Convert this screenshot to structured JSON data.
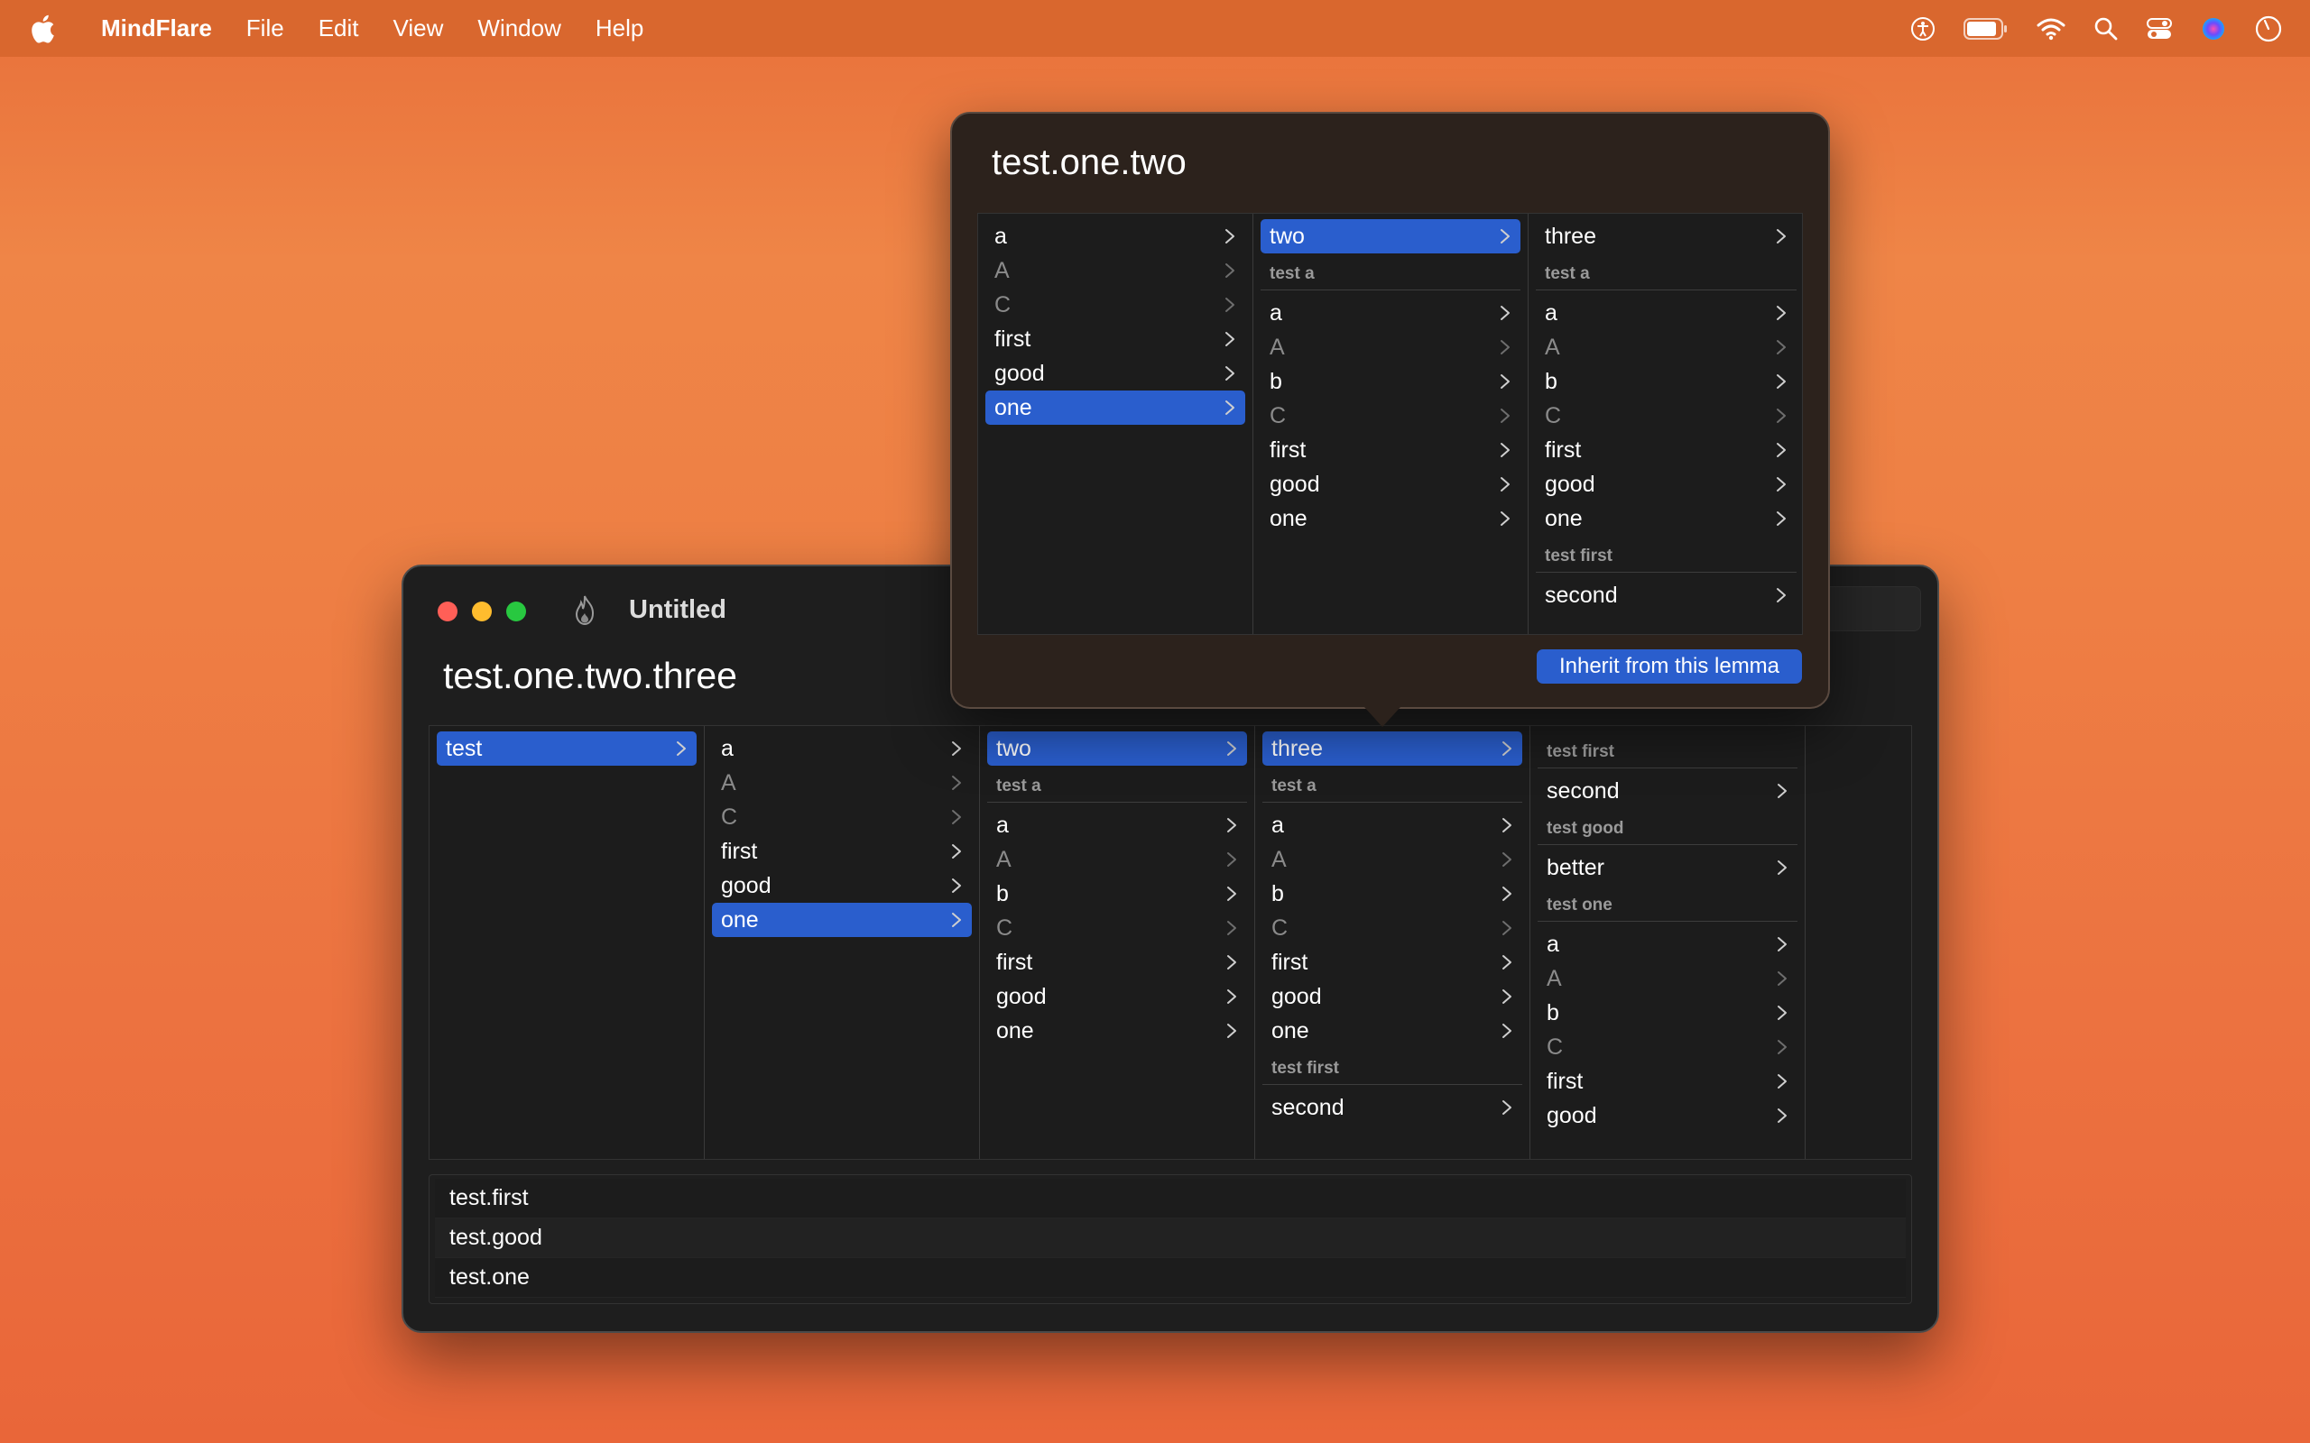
{
  "menubar": {
    "app_name": "MindFlare",
    "items": [
      "File",
      "Edit",
      "View",
      "Window",
      "Help"
    ]
  },
  "icons": {
    "apple": "apple-logo-icon",
    "status": [
      "accessibility-icon",
      "battery-icon",
      "wifi-icon",
      "search-icon",
      "control-center-icon",
      "siri-icon",
      "clock-icon"
    ]
  },
  "window": {
    "title": "Untitled",
    "path": "test.one.two.three",
    "columns": [
      {
        "groups": [
          {
            "header": "",
            "items": [
              {
                "label": "test",
                "selected": true,
                "dim": false
              }
            ]
          }
        ]
      },
      {
        "groups": [
          {
            "header": "",
            "items": [
              {
                "label": "a",
                "selected": false,
                "dim": false
              },
              {
                "label": "A",
                "selected": false,
                "dim": true
              },
              {
                "label": "C",
                "selected": false,
                "dim": true
              },
              {
                "label": "first",
                "selected": false,
                "dim": false
              },
              {
                "label": "good",
                "selected": false,
                "dim": false
              },
              {
                "label": "one",
                "selected": true,
                "dim": false
              }
            ]
          }
        ]
      },
      {
        "groups": [
          {
            "header": "",
            "items": [
              {
                "label": "two",
                "selected": true,
                "dim": false
              }
            ]
          },
          {
            "header": "test a",
            "items": [
              {
                "label": "a",
                "selected": false,
                "dim": false
              },
              {
                "label": "A",
                "selected": false,
                "dim": true
              },
              {
                "label": "b",
                "selected": false,
                "dim": false
              },
              {
                "label": "C",
                "selected": false,
                "dim": true
              },
              {
                "label": "first",
                "selected": false,
                "dim": false
              },
              {
                "label": "good",
                "selected": false,
                "dim": false
              },
              {
                "label": "one",
                "selected": false,
                "dim": false
              }
            ]
          }
        ]
      },
      {
        "groups": [
          {
            "header": "",
            "items": [
              {
                "label": "three",
                "selected": true,
                "dim": false
              }
            ]
          },
          {
            "header": "test a",
            "items": [
              {
                "label": "a",
                "selected": false,
                "dim": false
              },
              {
                "label": "A",
                "selected": false,
                "dim": true
              },
              {
                "label": "b",
                "selected": false,
                "dim": false
              },
              {
                "label": "C",
                "selected": false,
                "dim": true
              },
              {
                "label": "first",
                "selected": false,
                "dim": false
              },
              {
                "label": "good",
                "selected": false,
                "dim": false
              },
              {
                "label": "one",
                "selected": false,
                "dim": false
              }
            ]
          },
          {
            "header": "test first",
            "items": [
              {
                "label": "second",
                "selected": false,
                "dim": false
              }
            ]
          }
        ]
      },
      {
        "groups": [
          {
            "header": "test first",
            "items": [
              {
                "label": "second",
                "selected": false,
                "dim": false
              }
            ]
          },
          {
            "header": "test good",
            "items": [
              {
                "label": "better",
                "selected": false,
                "dim": false
              }
            ]
          },
          {
            "header": "test one",
            "items": [
              {
                "label": "a",
                "selected": false,
                "dim": false
              },
              {
                "label": "A",
                "selected": false,
                "dim": true
              },
              {
                "label": "b",
                "selected": false,
                "dim": false
              },
              {
                "label": "C",
                "selected": false,
                "dim": true
              },
              {
                "label": "first",
                "selected": false,
                "dim": false
              },
              {
                "label": "good",
                "selected": false,
                "dim": false
              }
            ]
          }
        ]
      }
    ],
    "bottom_list": [
      "test.first",
      "test.good",
      "test.one"
    ]
  },
  "popover": {
    "title": "test.one.two",
    "columns": [
      {
        "groups": [
          {
            "header": "",
            "items": [
              {
                "label": "a",
                "selected": false,
                "dim": false
              },
              {
                "label": "A",
                "selected": false,
                "dim": true
              },
              {
                "label": "C",
                "selected": false,
                "dim": true
              },
              {
                "label": "first",
                "selected": false,
                "dim": false
              },
              {
                "label": "good",
                "selected": false,
                "dim": false
              },
              {
                "label": "one",
                "selected": true,
                "dim": false
              }
            ]
          }
        ]
      },
      {
        "groups": [
          {
            "header": "",
            "items": [
              {
                "label": "two",
                "selected": true,
                "dim": false
              }
            ]
          },
          {
            "header": "test a",
            "items": [
              {
                "label": "a",
                "selected": false,
                "dim": false
              },
              {
                "label": "A",
                "selected": false,
                "dim": true
              },
              {
                "label": "b",
                "selected": false,
                "dim": false
              },
              {
                "label": "C",
                "selected": false,
                "dim": true
              },
              {
                "label": "first",
                "selected": false,
                "dim": false
              },
              {
                "label": "good",
                "selected": false,
                "dim": false
              },
              {
                "label": "one",
                "selected": false,
                "dim": false
              }
            ]
          }
        ]
      },
      {
        "groups": [
          {
            "header": "",
            "items": [
              {
                "label": "three",
                "selected": false,
                "dim": false
              }
            ]
          },
          {
            "header": "test a",
            "items": [
              {
                "label": "a",
                "selected": false,
                "dim": false
              },
              {
                "label": "A",
                "selected": false,
                "dim": true
              },
              {
                "label": "b",
                "selected": false,
                "dim": false
              },
              {
                "label": "C",
                "selected": false,
                "dim": true
              },
              {
                "label": "first",
                "selected": false,
                "dim": false
              },
              {
                "label": "good",
                "selected": false,
                "dim": false
              },
              {
                "label": "one",
                "selected": false,
                "dim": false
              }
            ]
          },
          {
            "header": "test first",
            "items": [
              {
                "label": "second",
                "selected": false,
                "dim": false
              }
            ]
          }
        ]
      }
    ],
    "button_label": "Inherit from this lemma"
  },
  "colors": {
    "desktop": "#ee7f44",
    "menubar": "#d9672e",
    "window_bg": "#1e1e1e",
    "selection": "#2a5ecd",
    "popover_bg": "#2c221c"
  }
}
